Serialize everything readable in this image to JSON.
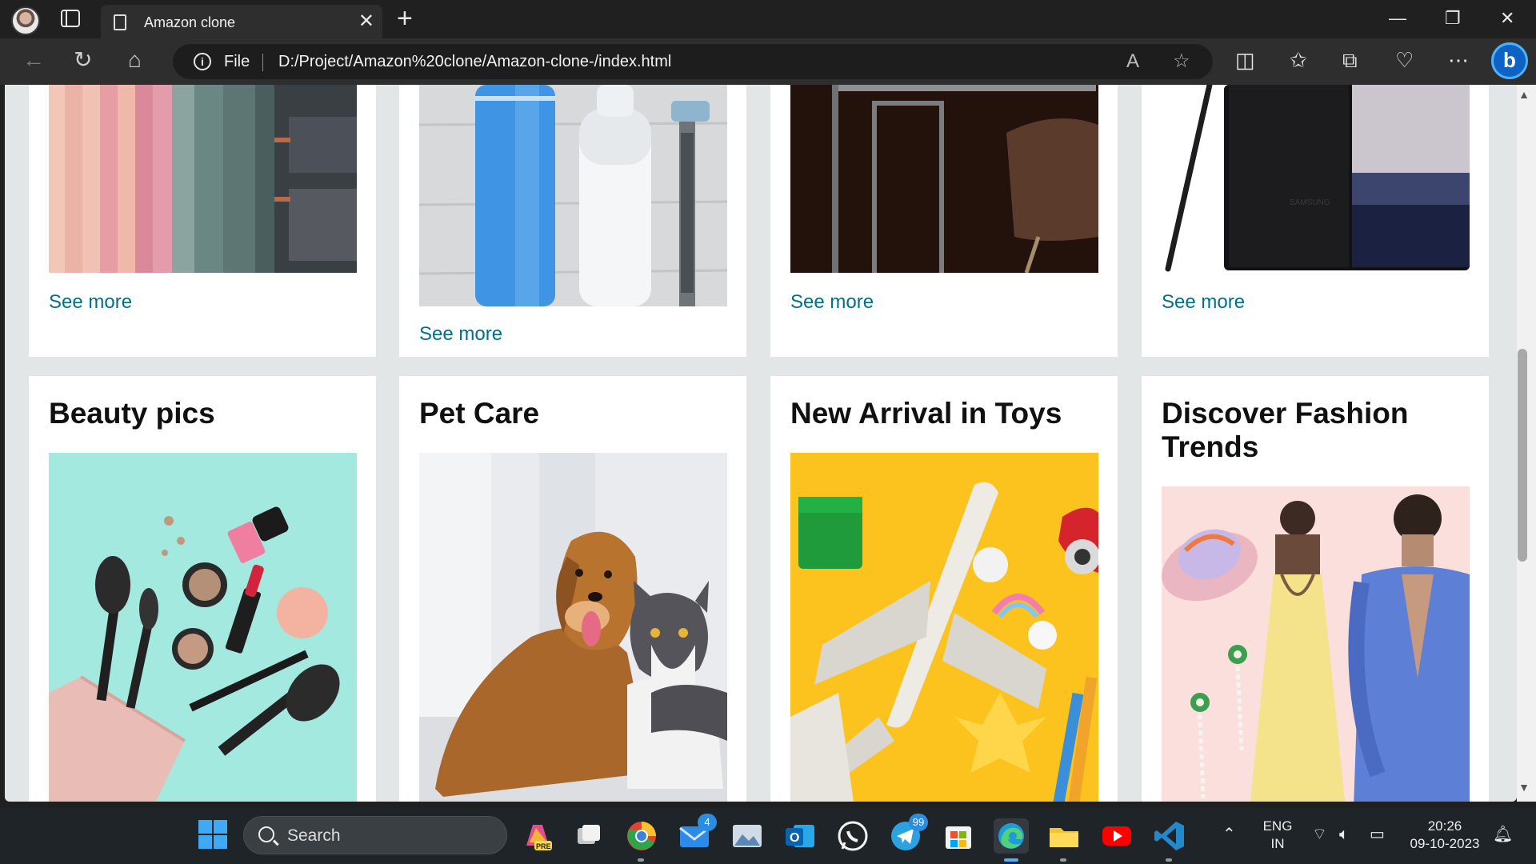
{
  "browser": {
    "tab_title": "Amazon clone",
    "tab_close": "✕",
    "new_tab": "+",
    "window_controls": [
      "—",
      "❐",
      "✕"
    ],
    "address_scheme": "File",
    "address_url": "D:/Project/Amazon%20clone/Amazon-clone-/index.html",
    "icons": [
      "profile-avatar",
      "tab-actions-icon",
      "back-icon",
      "refresh-icon",
      "home-icon",
      "info-icon",
      "read-aloud-icon",
      "favorite-star-icon",
      "split-screen-icon",
      "favorites-icon",
      "collections-icon",
      "browser-essentials-icon",
      "more-icon",
      "bing-copilot-icon"
    ]
  },
  "page": {
    "top_row": [
      {
        "see_more": "See more"
      },
      {
        "see_more": "See more"
      },
      {
        "see_more": "See more"
      },
      {
        "see_more": "See more"
      }
    ],
    "bottom_row": [
      {
        "title": "Beauty pics"
      },
      {
        "title": "Pet Care"
      },
      {
        "title": "New Arrival in Toys"
      },
      {
        "title": "Discover Fashion Trends"
      }
    ]
  },
  "taskbar": {
    "search_label": "Search",
    "mail_badge": "4",
    "telegram_badge": "99",
    "language": "ENG",
    "region": "IN",
    "time": "20:26",
    "date": "09-10-2023",
    "icons": [
      "start-icon",
      "copilot-pre-icon",
      "task-view-icon",
      "chrome-icon",
      "mail-icon",
      "photos-icon",
      "outlook-icon",
      "whatsapp-icon",
      "telegram-icon",
      "store-icon",
      "edge-icon",
      "file-explorer-icon",
      "youtube-icon",
      "vscode-icon"
    ]
  }
}
